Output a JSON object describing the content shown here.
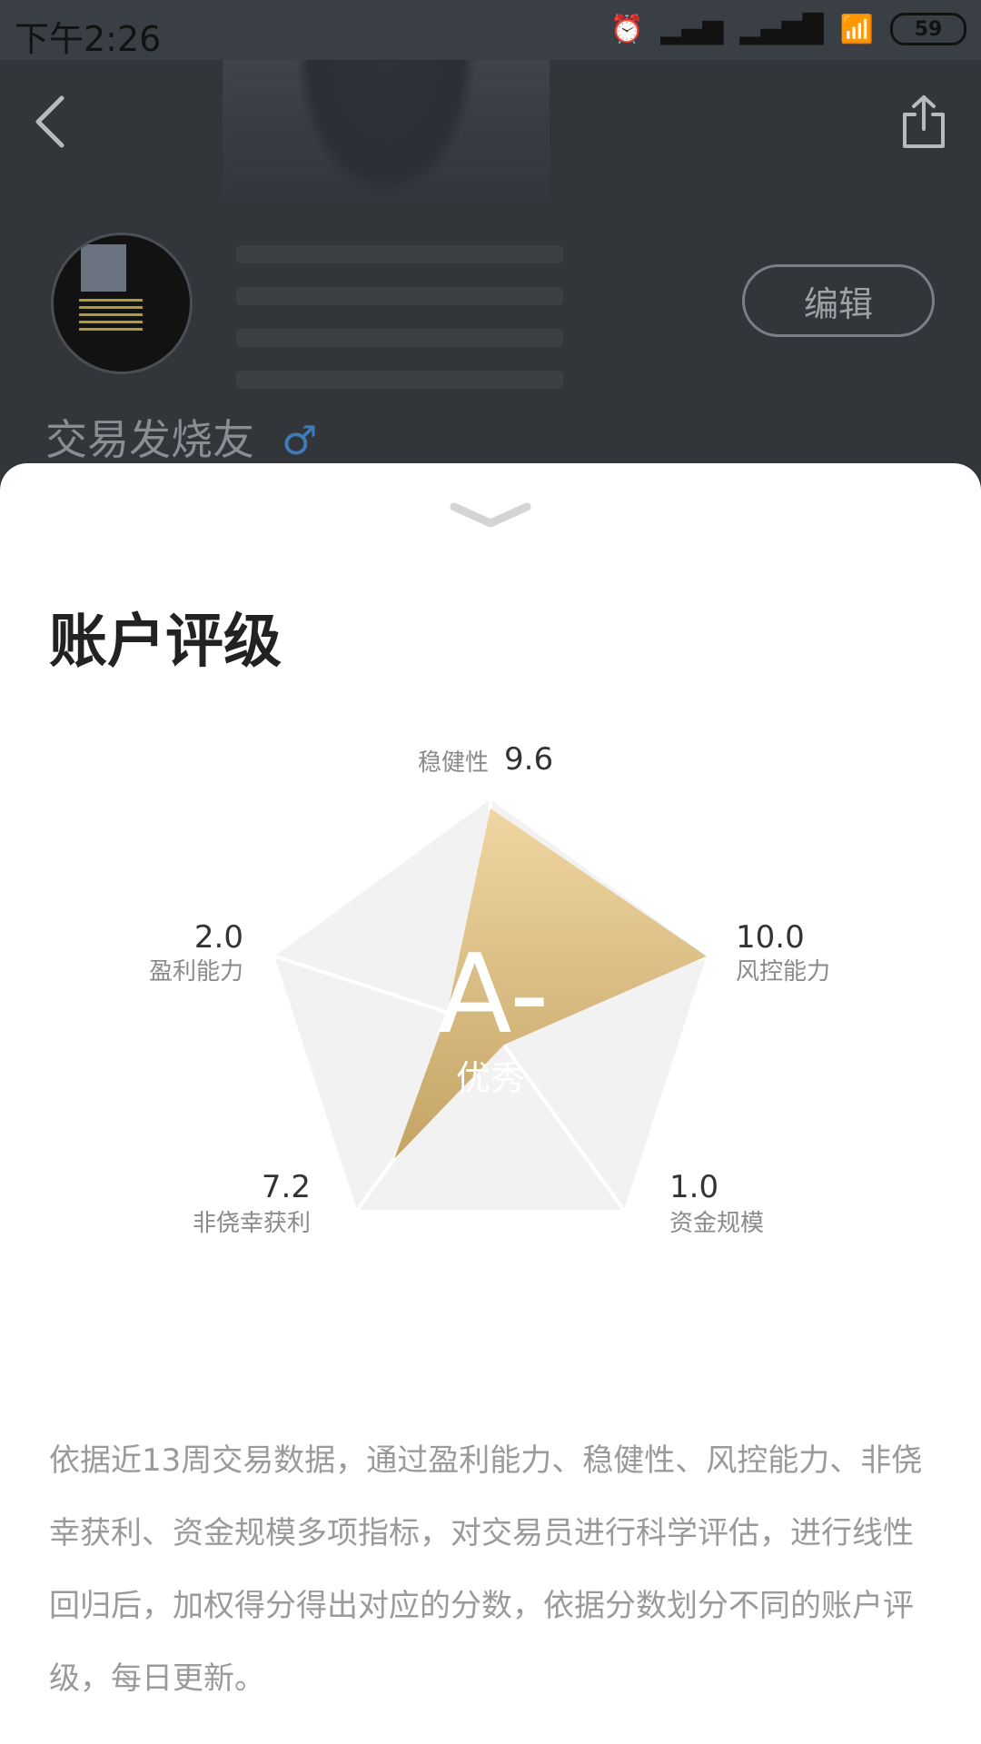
{
  "status_bar": {
    "time": "下午2:26",
    "battery": "59",
    "icons": [
      "alarm-icon",
      "signal-icon",
      "hd-signal-icon",
      "wifi-icon",
      "battery-icon"
    ]
  },
  "header": {
    "back_icon": "chevron-left-icon",
    "share_icon": "share-icon",
    "edit_label": "编辑",
    "username": "交易发烧友",
    "gender_symbol": "♂",
    "accent_color": "#3e7bb8"
  },
  "sheet": {
    "collapse_icon": "chevron-down-icon",
    "title": "账户评级",
    "grade": "A-",
    "grade_label": "优秀",
    "description": "依据近13周交易数据，通过盈利能力、稳健性、风控能力、非侥幸获利、资金规模多项指标，对交易员进行科学评估，进行线性回归后，加权得分得出对应的分数，依据分数划分不同的账户评级，每日更新。"
  },
  "chart_data": {
    "type": "radar",
    "axes": [
      "稳健性",
      "风控能力",
      "资金规模",
      "非侥幸获利",
      "盈利能力"
    ],
    "values": [
      9.6,
      10.0,
      1.0,
      7.2,
      2.0
    ],
    "value_labels": [
      "9.6",
      "10.0",
      "1.0",
      "7.2",
      "2.0"
    ],
    "range": [
      0,
      10
    ],
    "fill_color": "#d9b86f"
  }
}
